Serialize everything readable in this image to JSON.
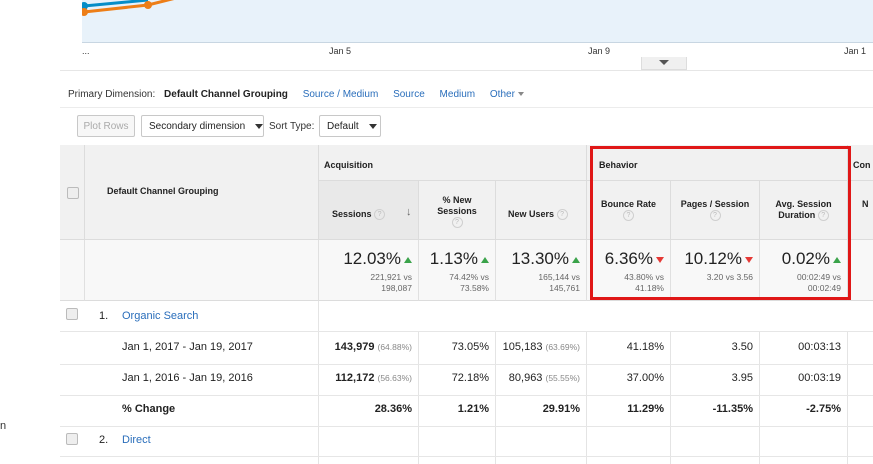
{
  "chart": {
    "x_ticks": [
      "...",
      "Jan 5",
      "Jan 9",
      "Jan 1"
    ],
    "series_colors": {
      "primary": "#058dc7",
      "compare": "#ed7e17"
    }
  },
  "dimension_bar": {
    "label": "Primary Dimension:",
    "current": "Default Channel Grouping",
    "links": [
      "Source / Medium",
      "Source",
      "Medium",
      "Other"
    ]
  },
  "toolbar": {
    "plot_rows": "Plot Rows",
    "secondary_dimension": "Secondary dimension",
    "sort_type_label": "Sort Type:",
    "sort_type_value": "Default"
  },
  "table": {
    "dimension_header": "Default Channel Grouping",
    "groups": {
      "acquisition": "Acquisition",
      "behavior": "Behavior",
      "conversions": "Con"
    },
    "columns": {
      "sessions": "Sessions",
      "new_sessions": "% New Sessions",
      "new_users": "New Users",
      "bounce_rate": "Bounce Rate",
      "pages_session": "Pages / Session",
      "avg_duration": "Avg. Session Duration",
      "next": "N"
    },
    "summary": {
      "sessions": {
        "change": "12.03%",
        "cmp1": "221,921 vs",
        "cmp2": "198,087"
      },
      "new_sessions": {
        "change": "1.13%",
        "cmp1": "74.42% vs",
        "cmp2": "73.58%"
      },
      "new_users": {
        "change": "13.30%",
        "cmp1": "165,144 vs",
        "cmp2": "145,761"
      },
      "bounce_rate": {
        "change": "6.36%",
        "cmp1": "43.80% vs",
        "cmp2": "41.18%"
      },
      "pages_session": {
        "change": "10.12%",
        "cmp1": "3.20 vs 3.56"
      },
      "avg_duration": {
        "change": "0.02%",
        "cmp1": "00:02:49 vs",
        "cmp2": "00:02:49"
      }
    },
    "rows": [
      {
        "index": "1.",
        "name": "Organic Search"
      },
      {
        "label": "Jan 1, 2017 - Jan 19, 2017",
        "sessions": "143,979",
        "sessions_pct": "(64.88%)",
        "new_sessions": "73.05%",
        "new_users": "105,183",
        "new_users_pct": "(63.69%)",
        "bounce_rate": "41.18%",
        "pages": "3.50",
        "duration": "00:03:13"
      },
      {
        "label": "Jan 1, 2016 - Jan 19, 2016",
        "sessions": "112,172",
        "sessions_pct": "(56.63%)",
        "new_sessions": "72.18%",
        "new_users": "80,963",
        "new_users_pct": "(55.55%)",
        "bounce_rate": "37.00%",
        "pages": "3.95",
        "duration": "00:03:19"
      },
      {
        "label": "% Change",
        "sessions": "28.36%",
        "new_sessions": "1.21%",
        "new_users": "29.91%",
        "bounce_rate": "11.29%",
        "pages": "-11.35%",
        "duration": "-2.75%"
      },
      {
        "index": "2.",
        "name": "Direct"
      }
    ]
  },
  "left_stub": "n"
}
